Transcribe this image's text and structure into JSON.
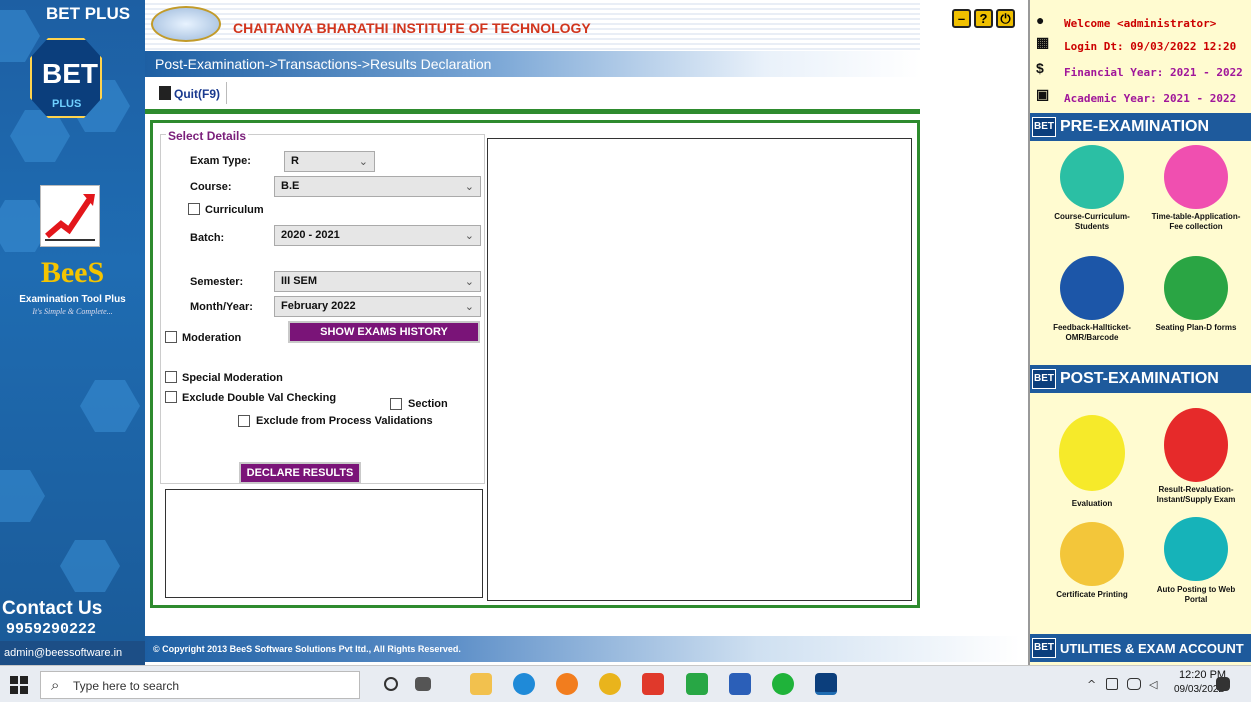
{
  "brand": {
    "bet_plus": "BET PLUS",
    "bet_logo_text": "BET",
    "bet_logo_plus": "PLUS",
    "bees": "BeeS",
    "tagline1": "Examination Tool Plus",
    "tagline2": "It's Simple & Complete...",
    "contact_title": "Contact Us",
    "contact_phone": "9959290222",
    "contact_email": "admin@beessoftware.in"
  },
  "header": {
    "college_name": "CHAITANYA BHARATHI INSTITUTE OF TECHNOLOGY",
    "breadcrumb": "Post-Examination->Transactions->Results Declaration",
    "quit_label": "Quit(F9)"
  },
  "form": {
    "legend": "Select Details",
    "exam_type_label": "Exam Type:",
    "exam_type_value": "R",
    "course_label": "Course:",
    "course_value": "B.E",
    "curriculum_label": "Curriculum",
    "batch_label": "Batch:",
    "batch_value": "2020 - 2021",
    "semester_label": "Semester:",
    "semester_value": "III SEM",
    "month_year_label": "Month/Year:",
    "month_year_value": "February 2022",
    "moderation_label": "Moderation",
    "show_history_label": "SHOW EXAMS HISTORY",
    "special_moderation_label": "Special Moderation",
    "exclude_double_label": "Exclude Double Val Checking",
    "section_label": "Section",
    "exclude_process_label": "Exclude from Process Validations",
    "declare_label": "DECLARE RESULTS"
  },
  "footer": {
    "copyright": "© Copyright 2013 BeeS Software Solutions Pvt ltd., All Rights Reserved."
  },
  "user_info": {
    "welcome": "Welcome <administrator>",
    "login": "Login Dt: 09/03/2022 12:20",
    "financial_year": "Financial Year: 2021 - 2022",
    "academic_year": "Academic Year: 2021 - 2022"
  },
  "sections": {
    "pre_exam": "PRE-EXAMINATION",
    "post_exam": "POST-EXAMINATION",
    "utilities": "UTILITIES & EXAM ACCOUNT",
    "tag": "BET"
  },
  "tiles": {
    "course": "Course-Curriculum-Students",
    "timetable": "Time-table-Application-Fee collection",
    "feedback": "Feedback-Hallticket-OMR/Barcode",
    "seating": "Seating Plan-D forms",
    "evaluation": "Evaluation",
    "result": "Result-Revaluation-Instant/Supply Exam",
    "certificate": "Certificate Printing",
    "autopost": "Auto Posting to Web Portal"
  },
  "taskbar": {
    "search_placeholder": "Type here to search",
    "time": "12:20 PM",
    "date": "09/03/2022"
  },
  "icons": {
    "minimize": "minimize-icon",
    "help": "help-icon",
    "power": "power-icon"
  }
}
